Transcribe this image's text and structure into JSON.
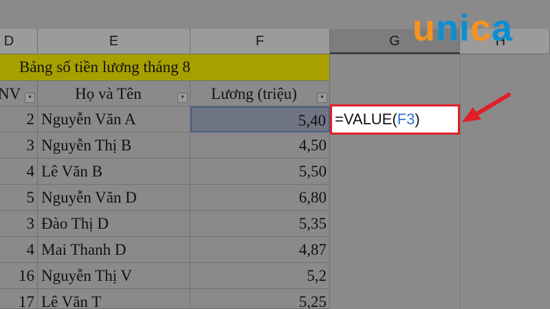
{
  "columns": [
    "D",
    "E",
    "F",
    "G",
    "H"
  ],
  "title": "Bảng số tiền lương tháng 8",
  "headers": {
    "id": "NV",
    "name": "Họ và Tên",
    "salary": "Lương (triệu)"
  },
  "rows": [
    {
      "id": "2",
      "name": "Nguyễn Văn A",
      "salary": "5,40"
    },
    {
      "id": "3",
      "name": "Nguyễn Thị B",
      "salary": "4,50"
    },
    {
      "id": "4",
      "name": "Lê Văn B",
      "salary": "5,50"
    },
    {
      "id": "5",
      "name": "Nguyễn Văn D",
      "salary": "6,80"
    },
    {
      "id": "3",
      "name": "Đào Thị D",
      "salary": "5,35"
    },
    {
      "id": "4",
      "name": "Mai Thanh D",
      "salary": "4,87"
    },
    {
      "id": "16",
      "name": "Nguyễn Thị V",
      "salary": "5,2"
    },
    {
      "id": "17",
      "name": "Lê Văn T",
      "salary": "5,25"
    }
  ],
  "formula": {
    "prefix": "=VALUE(",
    "ref": "F3",
    "suffix": ")"
  },
  "logo": {
    "u": "u",
    "ni": "ni",
    "c": "c",
    "a": "a"
  },
  "colors": {
    "title_bg": "#a6a000",
    "highlight": "#e21f26",
    "ref": "#2d6fd4"
  }
}
